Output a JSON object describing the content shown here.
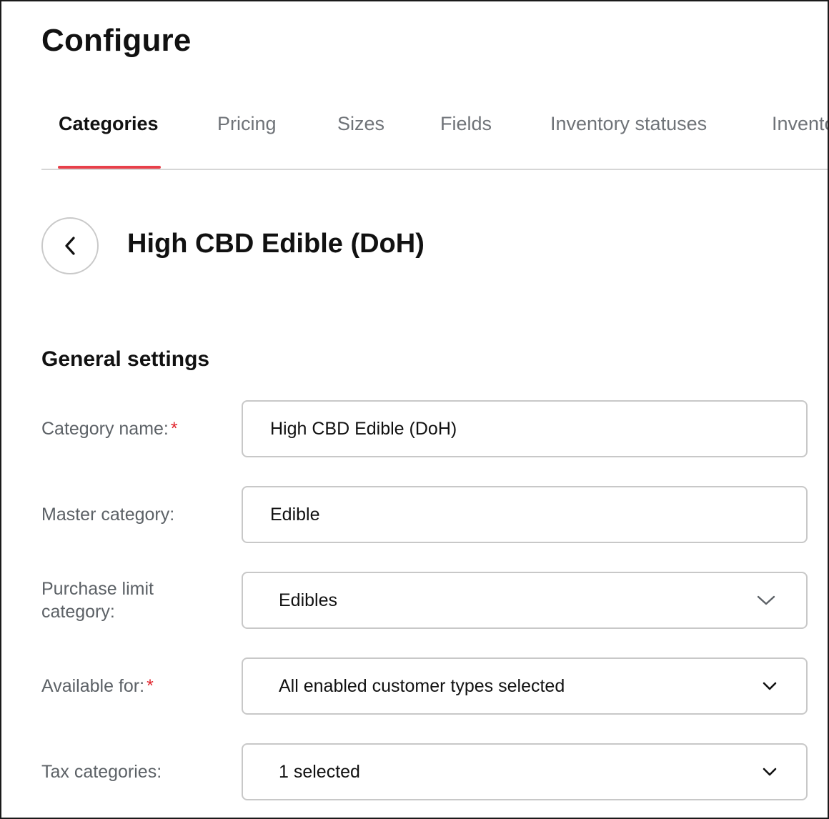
{
  "page": {
    "title": "Configure"
  },
  "tabs": [
    {
      "label": "Categories",
      "active": true
    },
    {
      "label": "Pricing"
    },
    {
      "label": "Sizes"
    },
    {
      "label": "Fields"
    },
    {
      "label": "Inventory statuses"
    },
    {
      "label": "Inventory"
    }
  ],
  "detail": {
    "title": "High CBD Edible (DoH)"
  },
  "section": {
    "title": "General settings"
  },
  "fields": {
    "category_name": {
      "label": "Category name:",
      "required": true,
      "value": "High CBD Edible (DoH)"
    },
    "master_category": {
      "label": "Master category:",
      "value": "Edible"
    },
    "purchase_limit": {
      "label_line1": "Purchase limit",
      "label_line2": "category:",
      "value": "Edibles"
    },
    "available_for": {
      "label": "Available for:",
      "required": true,
      "value": "All enabled customer types selected"
    },
    "tax_categories": {
      "label": "Tax categories:",
      "value": "1 selected"
    }
  },
  "required_marker": "*",
  "colors": {
    "accent": "#e8404a",
    "required": "#e0242c"
  },
  "icons": {
    "back": "chevron-left-icon",
    "dropdown": "chevron-down-icon"
  }
}
